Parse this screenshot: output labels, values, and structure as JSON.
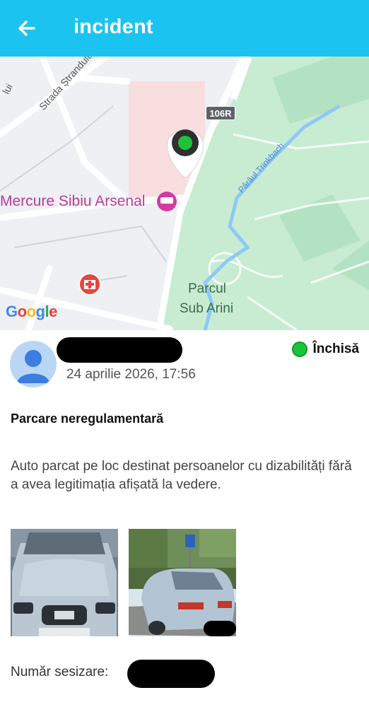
{
  "appbar": {
    "title": "incident",
    "back_icon": "arrow-left-icon",
    "background": "#1bc3f0"
  },
  "map": {
    "hotel_label": "Mercure Sibiu Arsenal",
    "park_label_line1": "Parcul",
    "park_label_line2": "Sub Arini",
    "street_label": "Strada Ștrandului",
    "street_label_partial": "lui",
    "creek_label": "Pârâul Trinkbach",
    "road_badge": "106R",
    "attribution": "Google",
    "pin_color": "#1cc43a"
  },
  "report": {
    "date": "24 aprilie 2026, 17:56",
    "status": "Închisă",
    "status_color": "#1cc43a",
    "type": "Parcare neregulamentară",
    "description": "Auto parcat pe loc destinat persoanelor cu dizabilități fără a avea legitimația afișată la vedere.",
    "ticket_label": "Număr sesizare:"
  },
  "photos": [
    {
      "icon": "car-front-photo"
    },
    {
      "icon": "car-rear-photo"
    }
  ]
}
